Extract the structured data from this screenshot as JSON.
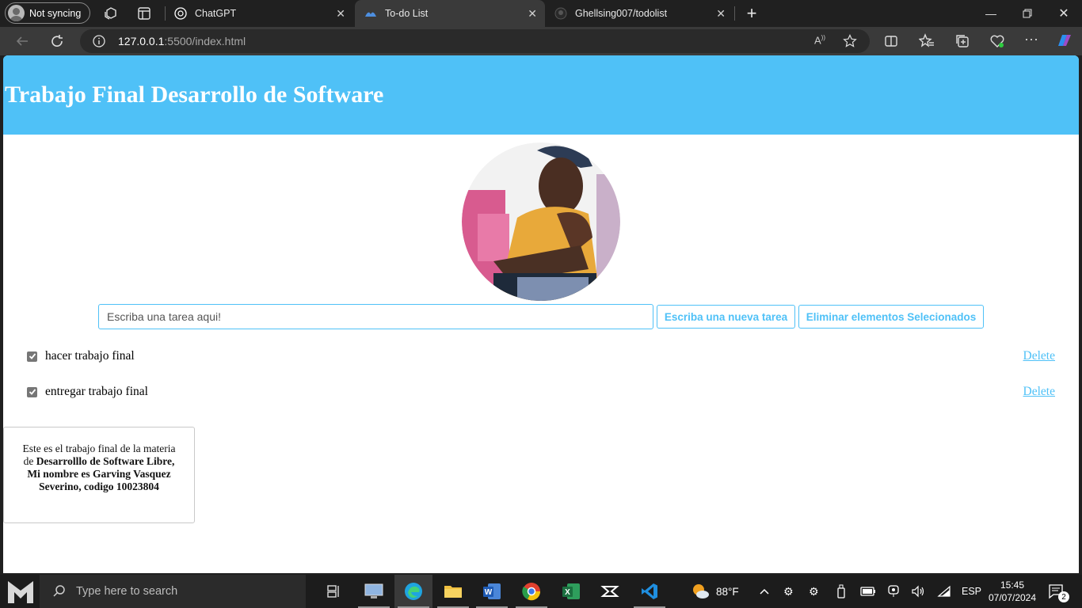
{
  "browser": {
    "profile_label": "Not syncing",
    "tabs": [
      {
        "title": "ChatGPT",
        "icon": "chatgpt-icon"
      },
      {
        "title": "To-do List",
        "icon": "vscode-live-server-icon",
        "active": true
      },
      {
        "title": "Ghellsing007/todolist",
        "icon": "github-icon"
      }
    ],
    "url_host": "127.0.0.1",
    "url_path": ":5500/index.html"
  },
  "page": {
    "title": "Trabajo Final Desarrollo de Software",
    "input_placeholder": "Escriba una tarea aqui!",
    "add_button": "Escriba una nueva tarea",
    "delete_selected_button": "Eliminar elementos Selecionados",
    "todos": [
      {
        "text": "hacer trabajo final",
        "checked": true,
        "delete_label": "Delete"
      },
      {
        "text": "entregar trabajo final",
        "checked": true,
        "delete_label": "Delete"
      }
    ],
    "footer": {
      "intro": "Este es el trabajo final de la materia de ",
      "bold": "Desarrolllo de Software Libre, Mi nombre es Garving Vasquez Severino, codigo 10023804"
    },
    "colors": {
      "accent": "#4fc1f7"
    }
  },
  "taskbar": {
    "search_placeholder": "Type here to search",
    "weather": "88°F",
    "language": "ESP",
    "time": "15:45",
    "date": "07/07/2024",
    "notifications": "2"
  }
}
